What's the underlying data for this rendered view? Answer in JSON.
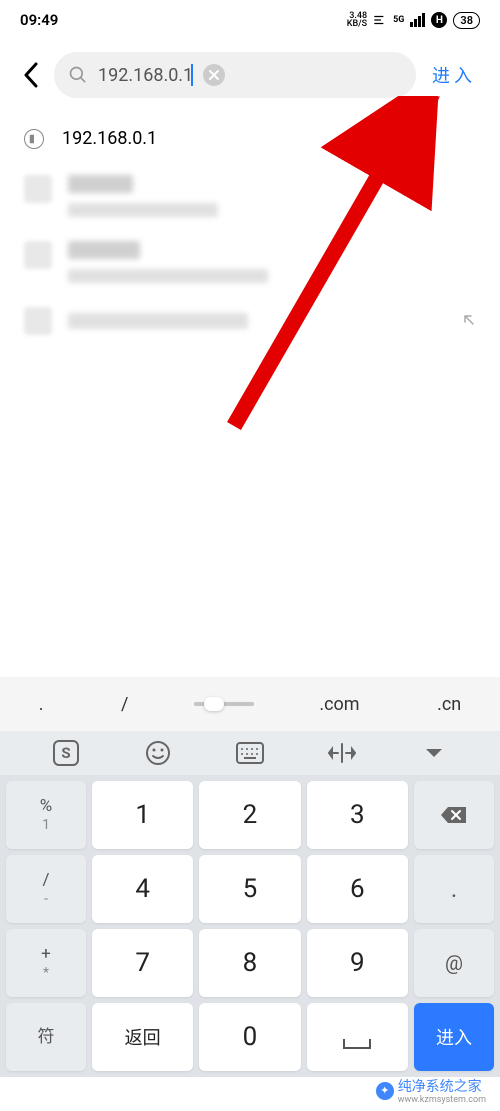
{
  "status": {
    "time": "09:49",
    "speed_val": "3.48",
    "speed_unit": "KB/S",
    "net": "5G",
    "h": "H",
    "battery": "38"
  },
  "search": {
    "value": "192.168.0.1",
    "enter_label": "进入"
  },
  "suggestion": {
    "first": "192.168.0.1"
  },
  "kb_suggest": {
    "dot": ".",
    "slash": "/",
    "com": ".com",
    "cn": ".cn"
  },
  "keys": {
    "percent": "%",
    "one": "1",
    "two": "2",
    "three": "3",
    "slash": "/",
    "four": "4",
    "five": "5",
    "six": "6",
    "plus": "+",
    "seven": "7",
    "eight": "8",
    "nine": "9",
    "at": "@",
    "zero": "0",
    "star": "*",
    "minus": "-",
    "dot_big": ".",
    "fu": "符",
    "back": "返回",
    "enter": "进入"
  },
  "watermark": {
    "text": "纯净系统之家",
    "sub": "www.kzmsystem.com"
  }
}
